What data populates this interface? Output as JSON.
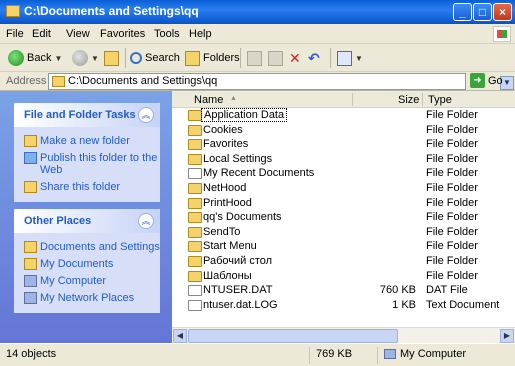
{
  "window": {
    "title": "C:\\Documents and Settings\\qq",
    "minimize_label": "_",
    "maximize_label": "□",
    "close_label": "×"
  },
  "menu": [
    "File",
    "Edit",
    "View",
    "Favorites",
    "Tools",
    "Help"
  ],
  "toolbar": {
    "back_label": "Back",
    "search_label": "Search",
    "folders_label": "Folders"
  },
  "address": {
    "label": "Address",
    "value": "C:\\Documents and Settings\\qq",
    "go_label": "Go"
  },
  "tasks_panel": {
    "title": "File and Folder Tasks",
    "items": [
      "Make a new folder",
      "Publish this folder to the Web",
      "Share this folder"
    ]
  },
  "places_panel": {
    "title": "Other Places",
    "items": [
      "Documents and Settings",
      "My Documents",
      "My Computer",
      "My Network Places"
    ]
  },
  "columns": {
    "name": "Name",
    "size": "Size",
    "type": "Type"
  },
  "files": [
    {
      "name": "Application Data",
      "size": "",
      "type": "File Folder",
      "icon": "folder-icon"
    },
    {
      "name": "Cookies",
      "size": "",
      "type": "File Folder",
      "icon": "folder-icon"
    },
    {
      "name": "Favorites",
      "size": "",
      "type": "File Folder",
      "icon": "favorites-folder-icon"
    },
    {
      "name": "Local Settings",
      "size": "",
      "type": "File Folder",
      "icon": "folder-icon"
    },
    {
      "name": "My Recent Documents",
      "size": "",
      "type": "File Folder",
      "icon": "recent-folder-icon"
    },
    {
      "name": "NetHood",
      "size": "",
      "type": "File Folder",
      "icon": "folder-icon"
    },
    {
      "name": "PrintHood",
      "size": "",
      "type": "File Folder",
      "icon": "folder-icon"
    },
    {
      "name": "qq's Documents",
      "size": "",
      "type": "File Folder",
      "icon": "documents-folder-icon"
    },
    {
      "name": "SendTo",
      "size": "",
      "type": "File Folder",
      "icon": "folder-icon"
    },
    {
      "name": "Start Menu",
      "size": "",
      "type": "File Folder",
      "icon": "folder-icon"
    },
    {
      "name": "Рабочий стол",
      "size": "",
      "type": "File Folder",
      "icon": "folder-icon"
    },
    {
      "name": "Шаблоны",
      "size": "",
      "type": "File Folder",
      "icon": "folder-icon"
    },
    {
      "name": "NTUSER.DAT",
      "size": "760 KB",
      "type": "DAT File",
      "icon": "file-icon"
    },
    {
      "name": "ntuser.dat.LOG",
      "size": "1 KB",
      "type": "Text Document",
      "icon": "text-file-icon"
    }
  ],
  "status": {
    "objects": "14 objects",
    "size": "769 KB",
    "location": "My Computer"
  }
}
